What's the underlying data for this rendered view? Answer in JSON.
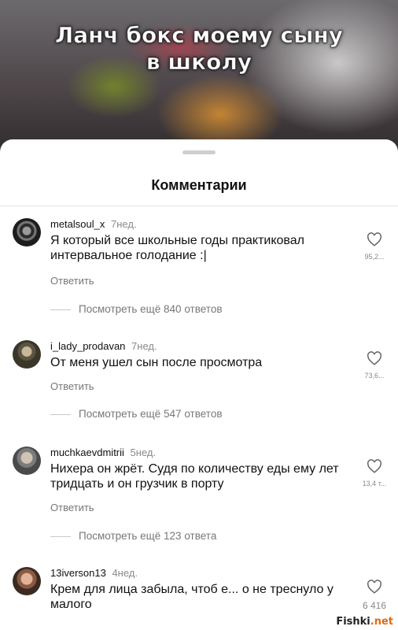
{
  "video": {
    "title_line1": "Ланч бокс моему сыну",
    "title_line2": "в школу"
  },
  "sheet": {
    "title": "Комментарии"
  },
  "reply_label": "Ответить",
  "comments": [
    {
      "username": "metalsoul_x",
      "time": "7нед.",
      "text": "Я который все школьные годы практиковал интервальное голодание :|",
      "likes": "95,2...",
      "more_replies": "Посмотреть ещё 840 ответов",
      "avatar_color": "#3a3a3a"
    },
    {
      "username": "i_lady_prodavan",
      "time": "7нед.",
      "text": "От меня ушел сын после просмотра",
      "likes": "73,6...",
      "more_replies": "Посмотреть ещё 547 ответов",
      "avatar_color": "#4a4535"
    },
    {
      "username": "muchkaevdmitrii",
      "time": "5нед.",
      "text": "Нихера он жрёт. Судя по количеству еды ему лет тридцать и он грузчик в порту",
      "likes": "13,4 т...",
      "more_replies": "Посмотреть ещё 123 ответа",
      "avatar_color": "#6b6b6b"
    },
    {
      "username": "13iverson13",
      "time": "4нед.",
      "text": "Крем для лица забыла, чтоб е... о не треснуло у малого",
      "likes": "6 416",
      "avatar_color": "#8a5a40"
    }
  ],
  "watermark": {
    "text": "Fishki",
    "suffix": ".net"
  },
  "colors": {
    "sheet_bg": "#ffffff",
    "secondary_text": "#777777"
  }
}
